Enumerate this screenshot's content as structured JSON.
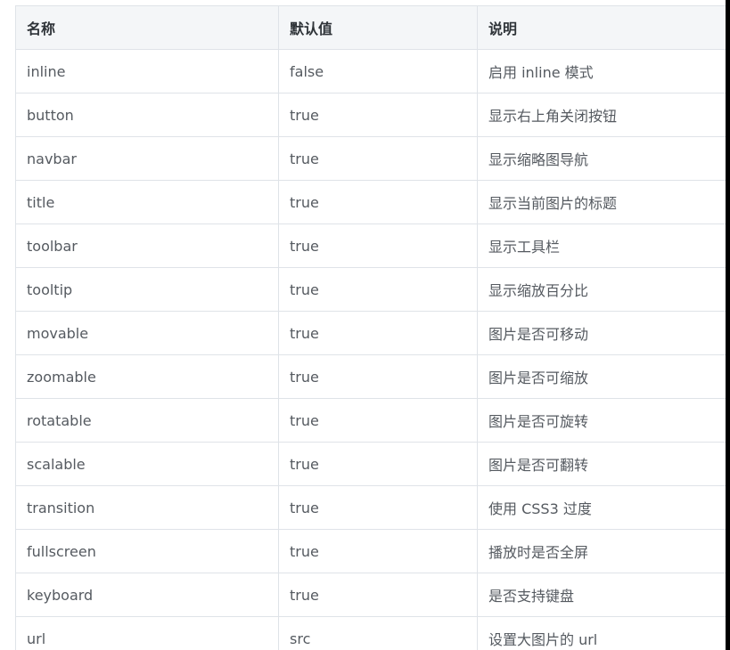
{
  "table": {
    "headers": [
      "名称",
      "默认值",
      "说明"
    ],
    "rows": [
      [
        "inline",
        "false",
        "启用 inline 模式"
      ],
      [
        "button",
        "true",
        "显示右上角关闭按钮"
      ],
      [
        "navbar",
        "true",
        "显示缩略图导航"
      ],
      [
        "title",
        "true",
        "显示当前图片的标题"
      ],
      [
        "toolbar",
        "true",
        "显示工具栏"
      ],
      [
        "tooltip",
        "true",
        "显示缩放百分比"
      ],
      [
        "movable",
        "true",
        "图片是否可移动"
      ],
      [
        "zoomable",
        "true",
        "图片是否可缩放"
      ],
      [
        "rotatable",
        "true",
        "图片是否可旋转"
      ],
      [
        "scalable",
        "true",
        "图片是否可翻转"
      ],
      [
        "transition",
        "true",
        "使用 CSS3 过度"
      ],
      [
        "fullscreen",
        "true",
        "播放时是否全屏"
      ],
      [
        "keyboard",
        "true",
        "是否支持键盘"
      ],
      [
        "url",
        "src",
        "设置大图片的 url"
      ]
    ]
  }
}
